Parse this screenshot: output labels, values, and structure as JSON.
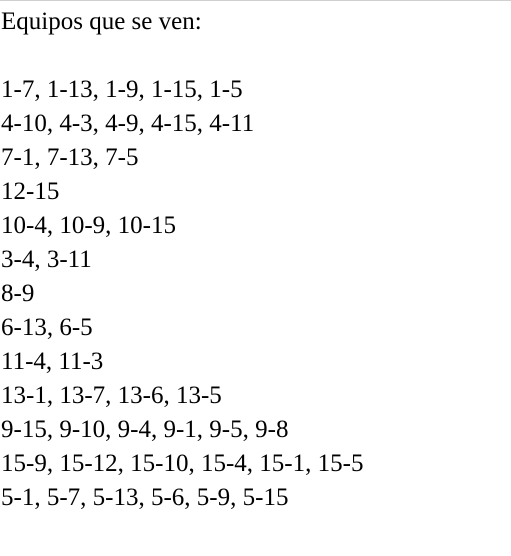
{
  "heading": "Equipos que se ven:",
  "rows": [
    "1-7, 1-13, 1-9, 1-15, 1-5",
    "4-10, 4-3, 4-9, 4-15, 4-11",
    "7-1, 7-13, 7-5",
    "12-15",
    "10-4, 10-9, 10-15",
    "3-4, 3-11",
    "8-9",
    "6-13, 6-5",
    "11-4, 11-3",
    "13-1, 13-7, 13-6, 13-5",
    "9-15, 9-10, 9-4, 9-1, 9-5, 9-8",
    "15-9, 15-12, 15-10, 15-4, 15-1, 15-5",
    "5-1, 5-7, 5-13, 5-6, 5-9, 5-15"
  ]
}
